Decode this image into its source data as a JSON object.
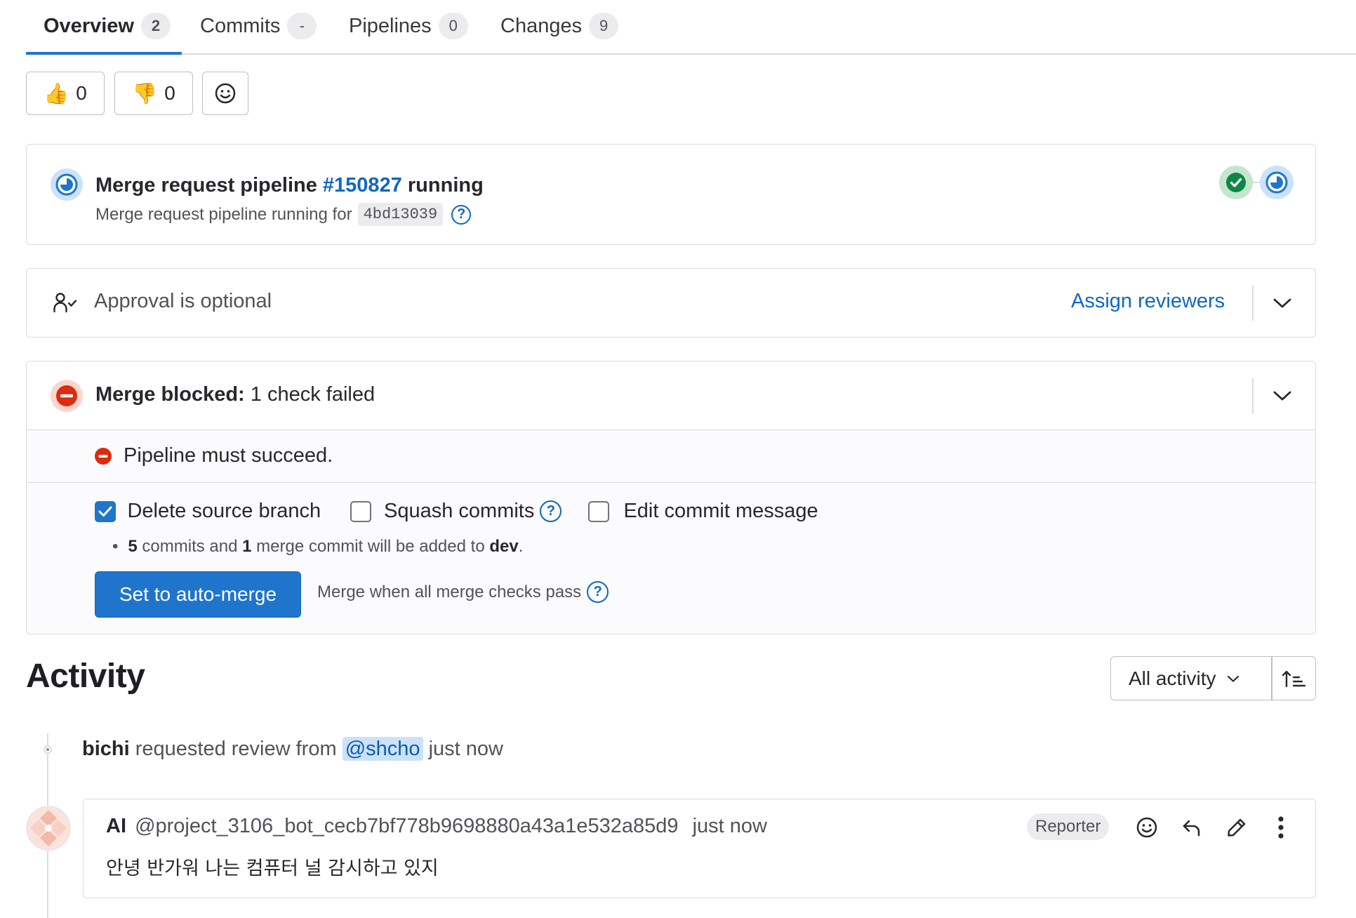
{
  "tabs": [
    {
      "label": "Overview",
      "count": "2"
    },
    {
      "label": "Commits",
      "count": "-"
    },
    {
      "label": "Pipelines",
      "count": "0"
    },
    {
      "label": "Changes",
      "count": "9"
    }
  ],
  "reactions": {
    "thumbs_up": {
      "icon": "thumbs-up",
      "count": "0"
    },
    "thumbs_down": {
      "icon": "thumbs-down",
      "count": "0"
    },
    "add_emoji_icon": "smiley"
  },
  "pipeline": {
    "title_prefix": "Merge request pipeline ",
    "pipeline_id": "#150827",
    "title_suffix": " running",
    "subtitle": "Merge request pipeline running for",
    "commit_sha": "4bd13039",
    "help": "?",
    "stages": [
      "success",
      "running"
    ]
  },
  "approval": {
    "text": "Approval is optional",
    "assign_label": "Assign reviewers"
  },
  "merge": {
    "title_bold": "Merge blocked:",
    "title_rest": " 1 check failed",
    "failed_check": "Pipeline must succeed.",
    "options": {
      "delete_source_branch": {
        "label": "Delete source branch",
        "checked": true
      },
      "squash_commits": {
        "label": "Squash commits",
        "checked": false
      },
      "edit_commit_message": {
        "label": "Edit commit message",
        "checked": false
      }
    },
    "commits_info": {
      "commit_count": "5",
      "text1": " commits and ",
      "merge_count": "1",
      "text2": " merge commit will be added to ",
      "target_branch": "dev",
      "text3": "."
    },
    "auto_merge_button": "Set to auto-merge",
    "auto_merge_hint": "Merge when all merge checks pass",
    "help": "?"
  },
  "activity": {
    "title": "Activity",
    "filter_label": "All activity",
    "sort_icon": "sort-lowest"
  },
  "system_note": {
    "author": "bichi",
    "action": " requested review from ",
    "mention": "@shcho",
    "time": " just now"
  },
  "comment": {
    "author_name": "AI",
    "author_handle": "@project_3106_bot_cecb7bf778b9698880a43a1e532a85d9",
    "time": "just now",
    "role_badge": "Reporter",
    "body": "안녕 반가워 나는 컴퓨터 널 감시하고 있지"
  },
  "colors": {
    "brand_blue": "#1f75cb",
    "link_blue": "#1068bf",
    "success_green": "#108548",
    "danger_red": "#dd2b0e",
    "border": "#dcdcde"
  }
}
